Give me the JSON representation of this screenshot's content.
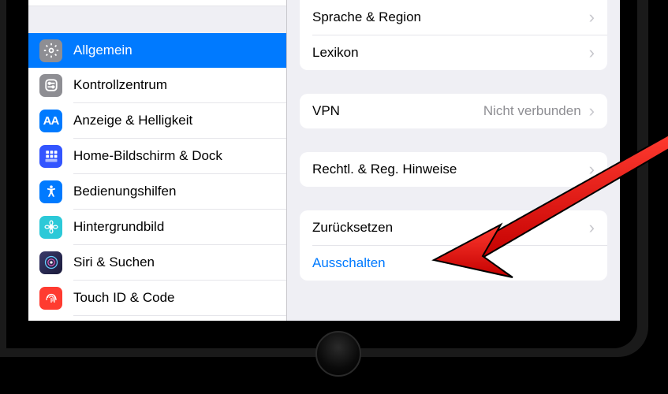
{
  "sidebar": {
    "items": [
      {
        "label": "Allgemein",
        "selected": true
      },
      {
        "label": "Kontrollzentrum"
      },
      {
        "label": "Anzeige & Helligkeit"
      },
      {
        "label": "Home-Bildschirm & Dock"
      },
      {
        "label": "Bedienungshilfen"
      },
      {
        "label": "Hintergrundbild"
      },
      {
        "label": "Siri & Suchen"
      },
      {
        "label": "Touch ID & Code"
      }
    ]
  },
  "detail": {
    "sprache_region": "Sprache & Region",
    "lexikon": "Lexikon",
    "vpn_label": "VPN",
    "vpn_value": "Nicht verbunden",
    "legal": "Rechtl. & Reg. Hinweise",
    "reset": "Zurücksetzen",
    "shutdown": "Ausschalten"
  },
  "annotation": {
    "arrow_points_to": "Ausschalten"
  }
}
